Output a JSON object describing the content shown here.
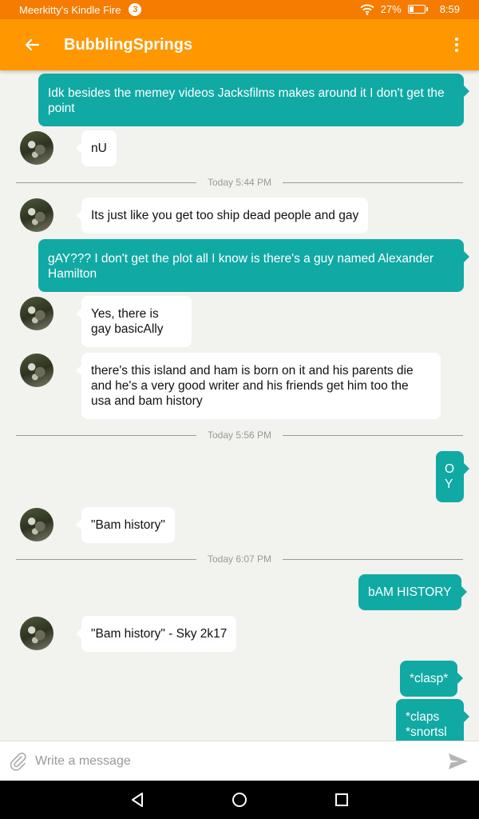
{
  "status": {
    "device_name": "Meerkitty's Kindle Fire",
    "notification_count": "3",
    "battery": "27%",
    "battery_level": 0.27,
    "time": "8:59"
  },
  "appbar": {
    "title": "BubblingSprings"
  },
  "messages": {
    "m1": "Idk besides the memey videos Jacksfilms makes around it I don't get the point",
    "m2": "nU",
    "sep1": "Today 5:44 PM",
    "m3": "Its just like you get too ship dead people and gay",
    "m4": "gAY??? I don't get the plot all I know is there's a guy named Alexander Hamilton",
    "m5": "Yes, there is gay basicAlly",
    "m6": "there's this island and ham is born on it and his parents die and he's a very good writer and his friends get him too the usa and bam history",
    "sep2": "Today 5:56 PM",
    "m7": "O Y",
    "m8": "\"Bam history\"",
    "sep3": "Today 6:07 PM",
    "m9": "bAM HISTORY",
    "m10": "\"Bam history\" - Sky 2k17",
    "m11": "*clasp*",
    "m12": "*claps *snortsl"
  },
  "composer": {
    "placeholder": "Write a message"
  },
  "colors": {
    "accent": "#ff9800",
    "status_bar": "#f57c00",
    "outgoing_bubble": "#10a9a4",
    "incoming_bubble": "#ffffff"
  },
  "icons": [
    "back-arrow-icon",
    "more-vert-icon",
    "wifi-icon",
    "battery-icon",
    "paperclip-icon",
    "send-icon",
    "nav-back-icon",
    "nav-home-icon",
    "nav-recents-icon"
  ]
}
